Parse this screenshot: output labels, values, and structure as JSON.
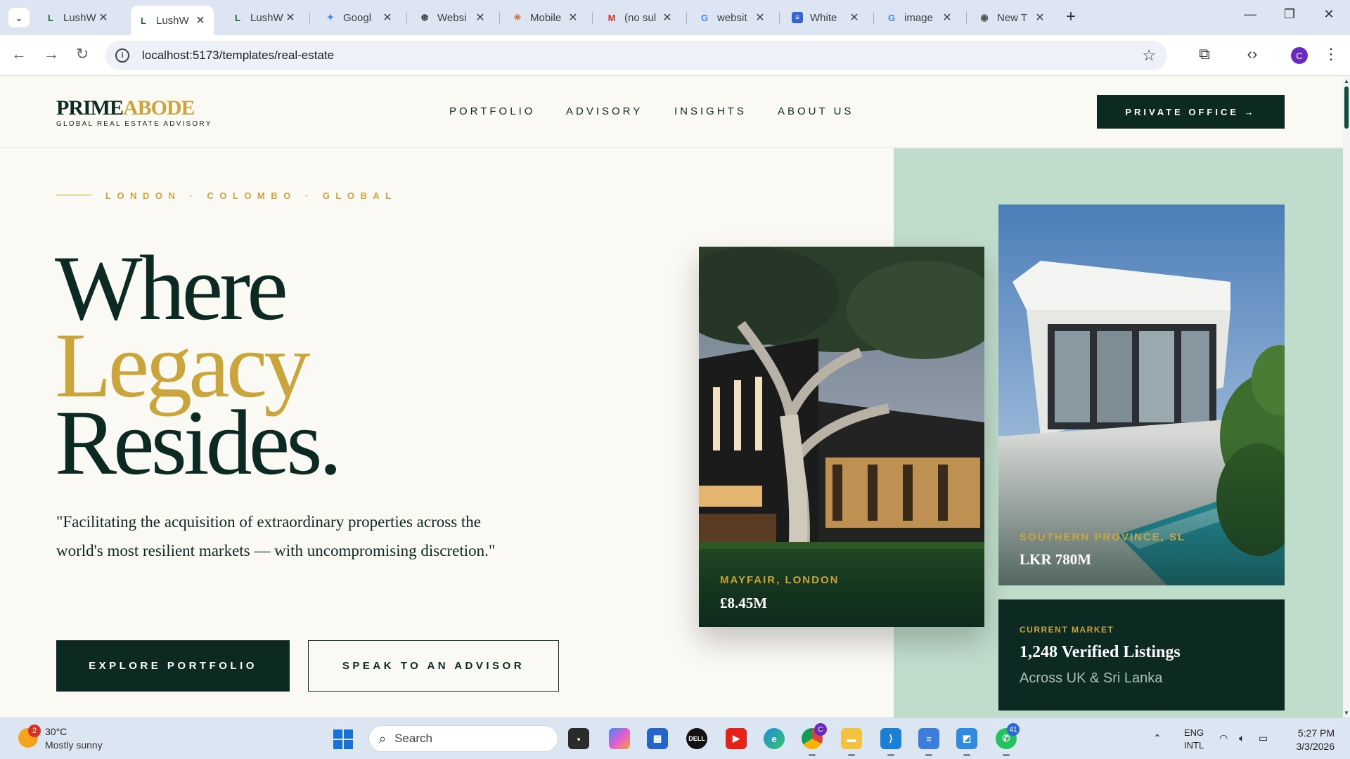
{
  "browser": {
    "tabs": [
      {
        "label": "LushW",
        "favicon": "L",
        "active": false
      },
      {
        "label": "LushW",
        "favicon": "L",
        "active": true
      },
      {
        "label": "LushW",
        "favicon": "L",
        "active": false
      },
      {
        "label": "Googl",
        "favicon": "gemini-star",
        "active": false
      },
      {
        "label": "Websi",
        "favicon": "openai-knot",
        "active": false
      },
      {
        "label": "Mobile",
        "favicon": "asterisk",
        "active": false
      },
      {
        "label": "(no sul",
        "favicon": "gmail-m",
        "active": false
      },
      {
        "label": "websit",
        "favicon": "google-g",
        "active": false
      },
      {
        "label": "White",
        "favicon": "doc-icon",
        "active": false
      },
      {
        "label": "image",
        "favicon": "google-g",
        "active": false
      },
      {
        "label": "New T",
        "favicon": "chrome",
        "active": false
      }
    ],
    "url": "localhost:5173/templates/real-estate",
    "profile_initial": "C",
    "accent": "#0c2a22"
  },
  "site": {
    "logo_prime": "PRIME",
    "logo_abode": "ABODE",
    "logo_sub": "GLOBAL REAL ESTATE ADVISORY",
    "nav": [
      "PORTFOLIO",
      "ADVISORY",
      "INSIGHTS",
      "ABOUT US"
    ],
    "cta": "PRIVATE OFFICE →"
  },
  "hero": {
    "kicker": "LONDON · COLOMBO · GLOBAL",
    "line1": "Where",
    "line2": "Legacy",
    "line3": "Resides.",
    "quote": "\"Facilitating the acquisition of extraordinary properties across the world's most resilient markets — with uncompromising discretion.\"",
    "btn_primary": "EXPLORE PORTFOLIO",
    "btn_secondary": "SPEAK TO AN ADVISOR"
  },
  "cards": [
    {
      "location": "MAYFAIR, LONDON",
      "price": "£8.45M"
    },
    {
      "location": "SOUTHERN PROVINCE, SL",
      "price": "LKR 780M"
    }
  ],
  "market": {
    "label": "CURRENT MARKET",
    "title": "1,248 Verified Listings",
    "sub": "Across UK & Sri Lanka"
  },
  "taskbar": {
    "weather_badge": "2",
    "temp": "30°C",
    "condition": "Mostly sunny",
    "search": "Search",
    "whatsapp_badge": "41",
    "chrome_badge": "C",
    "lang1": "ENG",
    "lang2": "INTL",
    "time": "5:27 PM",
    "date": "3/3/2026"
  },
  "colors": {
    "gold": "#c9a53c",
    "dark_green": "#0c2a22",
    "sage_panel": "#c0dccb",
    "cream": "#fbf9f4"
  }
}
